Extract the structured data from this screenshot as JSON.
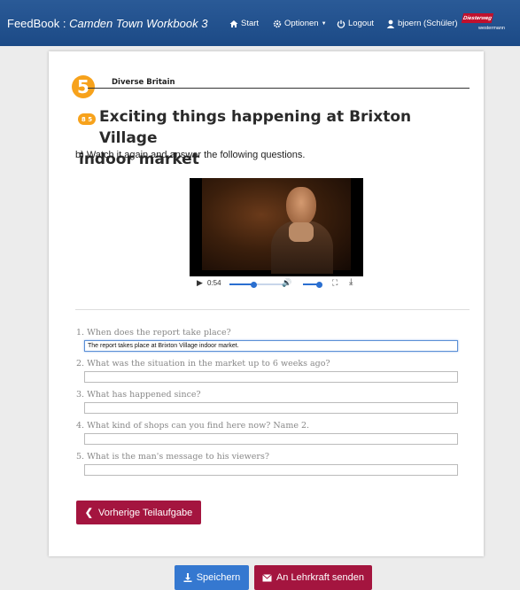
{
  "navbar": {
    "brand": "FeedBook :",
    "book_title": "Camden Town Workbook 3",
    "start_label": "Start",
    "options_label": "Optionen",
    "logout_label": "Logout",
    "user_label": "bjoern (Schüler)",
    "logo_text": "Diesterweg",
    "logo_subtext": "westermann"
  },
  "chapter": {
    "number": "5",
    "title": "Diverse Britain"
  },
  "task": {
    "badge": "8 5",
    "title_line1": "Exciting things happening at Brixton Village",
    "title_line2": "indoor market",
    "instruction": "b) Watch it again and answer the following questions."
  },
  "video": {
    "time": "0:54",
    "progress": 0.45,
    "volume": 0.8
  },
  "questions": [
    {
      "label": "1. When does the report take place?",
      "answer": "The report takes place at Brixton Village indoor market."
    },
    {
      "label": "2. What was the situation in the market up to 6 weeks ago?",
      "answer": ""
    },
    {
      "label": "3. What has happened since?",
      "answer": ""
    },
    {
      "label": "4. What kind of shops can you find here now? Name 2.",
      "answer": ""
    },
    {
      "label": "5. What is the man's message to his viewers?",
      "answer": ""
    }
  ],
  "buttons": {
    "previous": "Vorherige Teilaufgabe",
    "save": "Speichern",
    "send": "An Lehrkraft senden"
  },
  "colors": {
    "navbar": "#1f4d8a",
    "accent_orange": "#f7a21b",
    "button_red": "#a4153f",
    "button_blue": "#3578d0"
  }
}
